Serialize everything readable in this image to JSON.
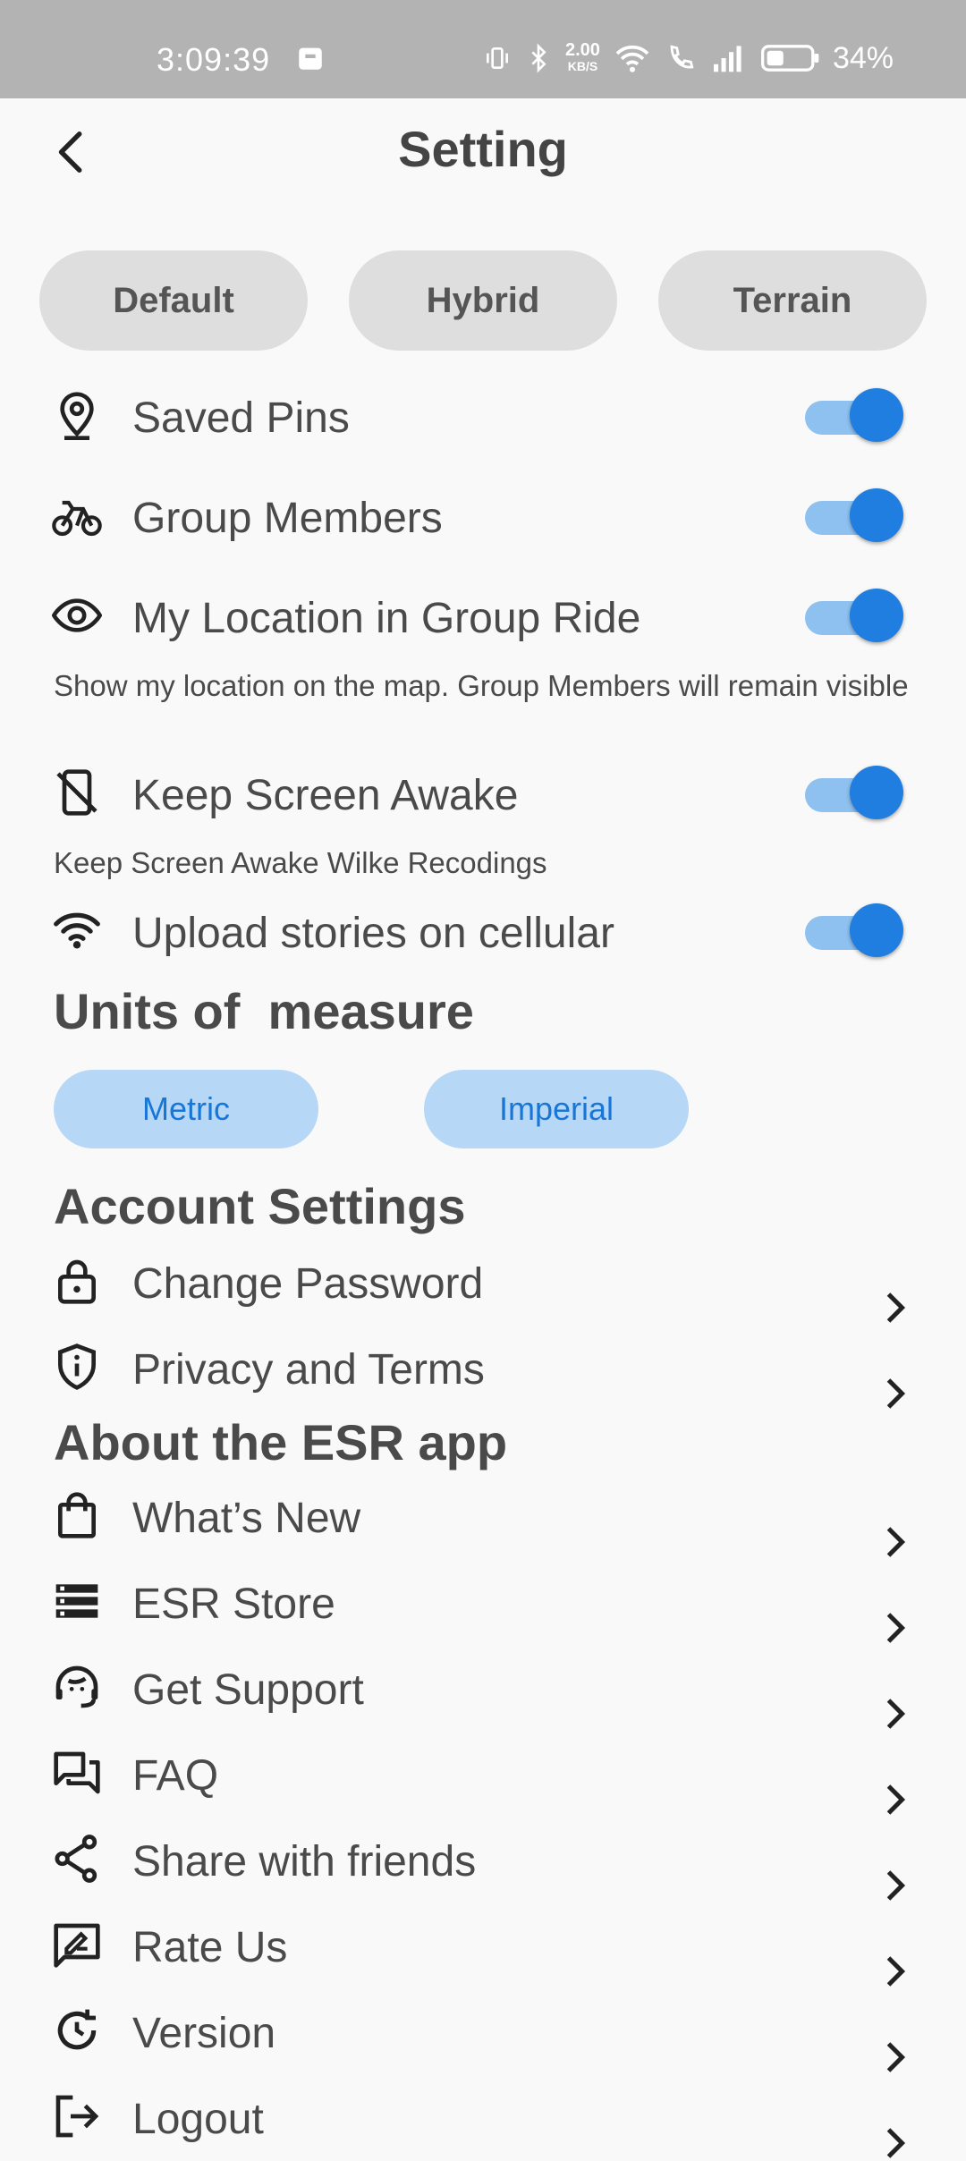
{
  "status_bar": {
    "time": "3:09:39",
    "net_speed": "2.00",
    "net_unit": "KB/S",
    "battery": "34%"
  },
  "header": {
    "title": "Setting"
  },
  "map_types": [
    "Default",
    "Hybrid",
    "Terrain"
  ],
  "toggles": [
    {
      "label": "Saved Pins",
      "icon": "location-pin-icon",
      "on": true
    },
    {
      "label": "Group Members",
      "icon": "bicycle-icon",
      "on": true
    },
    {
      "label": "My Location in Group Ride",
      "icon": "eye-icon",
      "on": true,
      "description": "Show my location on the map. Group Members will remain visible"
    },
    {
      "label": "Keep Screen Awake",
      "icon": "phone-off-icon",
      "on": true,
      "description": "Keep Screen Awake Wilke Recodings"
    },
    {
      "label": "Upload stories on cellular",
      "icon": "wifi-icon",
      "on": true
    }
  ],
  "units": {
    "title": "Units of  measure",
    "options": [
      "Metric",
      "Imperial"
    ]
  },
  "account": {
    "title": "Account Settings",
    "items": [
      {
        "label": "Change Password",
        "icon": "lock-icon"
      },
      {
        "label": "Privacy and Terms",
        "icon": "shield-info-icon"
      }
    ]
  },
  "about": {
    "title": "About the ESR app",
    "items": [
      {
        "label": "What’s New",
        "icon": "shopping-bag-icon"
      },
      {
        "label": "ESR Store",
        "icon": "store-list-icon"
      },
      {
        "label": "Get Support",
        "icon": "support-agent-icon"
      },
      {
        "label": "FAQ",
        "icon": "chat-bubbles-icon"
      },
      {
        "label": "Share with friends",
        "icon": "share-icon"
      },
      {
        "label": "Rate Us",
        "icon": "rate-review-icon"
      },
      {
        "label": "Version",
        "icon": "version-clock-icon"
      },
      {
        "label": "Logout",
        "icon": "logout-icon"
      }
    ]
  },
  "colors": {
    "accent": "#1f7ee0",
    "toggle_track": "#8ec1f0",
    "unit_button_bg": "#b6d7f6",
    "map_button_bg": "#dedede",
    "status_bar_bg": "#b3b3b3"
  }
}
